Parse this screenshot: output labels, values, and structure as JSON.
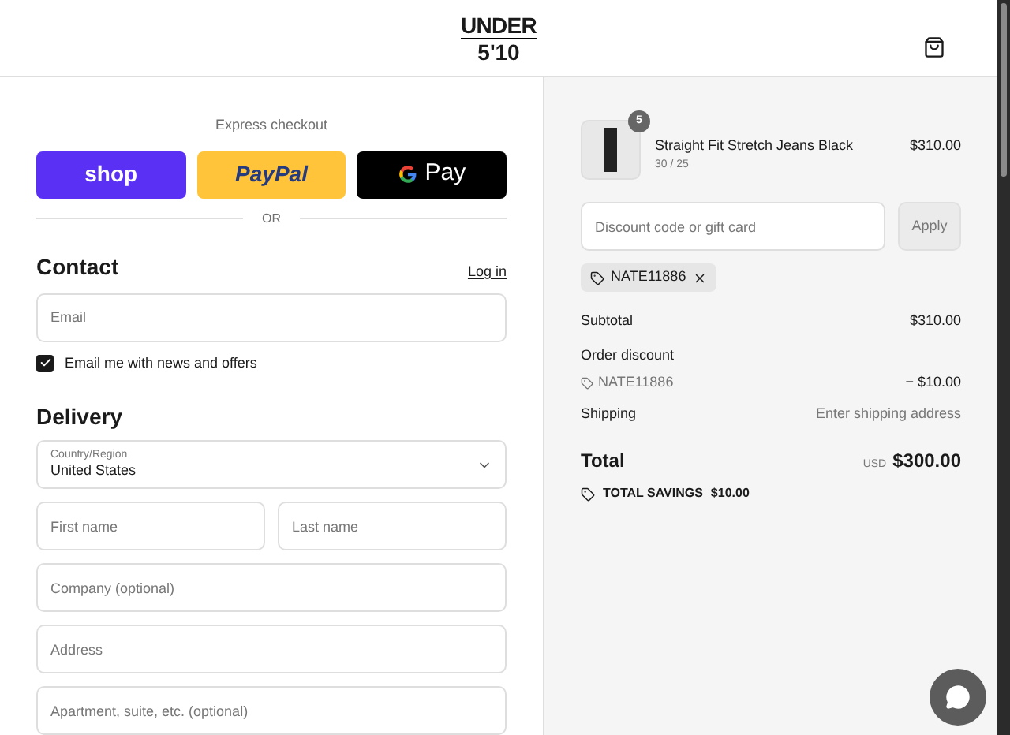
{
  "header": {
    "logo_top": "UNDER",
    "logo_bottom": "5'10"
  },
  "express": {
    "title": "Express checkout",
    "buttons": [
      {
        "kind": "shop",
        "label": "shop"
      },
      {
        "kind": "paypal",
        "label": "PayPal"
      },
      {
        "kind": "gpay",
        "label": "Pay"
      }
    ],
    "divider": "OR"
  },
  "contact": {
    "title": "Contact",
    "login": "Log in",
    "email": {
      "placeholder": "Email"
    },
    "newsletter": {
      "label": "Email me with news and offers",
      "checked": true
    }
  },
  "delivery": {
    "title": "Delivery",
    "country": {
      "label": "Country/Region",
      "value": "United States"
    },
    "fields": [
      {
        "placeholder": "First name"
      },
      {
        "placeholder": "Last name"
      },
      {
        "placeholder": "Company (optional)"
      },
      {
        "placeholder": "Address"
      },
      {
        "placeholder": "Apartment, suite, etc. (optional)"
      }
    ]
  },
  "summary": {
    "item": {
      "quantity": "5",
      "name": "Straight Fit Stretch Jeans Black",
      "variant": "30 / 25",
      "price": "$310.00"
    },
    "discount": {
      "placeholder": "Discount code or gift card",
      "button": "Apply",
      "applied": "NATE11886"
    },
    "subtotal": {
      "label": "Subtotal",
      "value": "$310.00"
    },
    "order_discount": {
      "label": "Order discount",
      "code": "NATE11886",
      "value": "− $10.00"
    },
    "shipping": {
      "label": "Shipping",
      "value": "Enter shipping address"
    },
    "total": {
      "label": "Total",
      "currency": "USD",
      "value": "$300.00"
    },
    "savings": {
      "label": "TOTAL SAVINGS",
      "value": "$10.00"
    }
  }
}
